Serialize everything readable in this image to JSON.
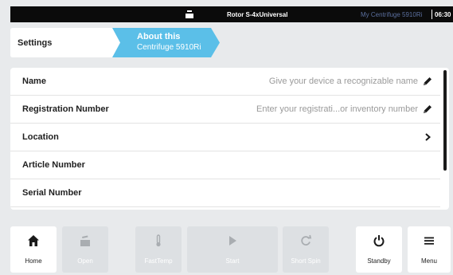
{
  "status_bar": {
    "rotor_icon": "rotor-icon",
    "rotor": "Rotor S-4xUniversal",
    "device": "My Centrifuge 5910Ri",
    "time": "06:30"
  },
  "breadcrumb": {
    "home": "Settings",
    "current_line1": "About this",
    "current_line2": "Centrifuge 5910Ri"
  },
  "rows": [
    {
      "label": "Name",
      "value": "Give your device a recognizable name",
      "action_icon": "pencil-icon"
    },
    {
      "label": "Registration Number",
      "value": "Enter your registrati...or inventory number",
      "action_icon": "pencil-icon"
    },
    {
      "label": "Location",
      "value": "",
      "action_icon": "chevron-right-icon"
    },
    {
      "label": "Article Number",
      "value": ""
    },
    {
      "label": "Serial Number",
      "value": ""
    }
  ],
  "nav": [
    {
      "label": "Home",
      "icon": "home-icon",
      "enabled": true
    },
    {
      "label": "Open",
      "icon": "lid-icon",
      "enabled": false
    },
    {
      "label": "FastTemp",
      "icon": "thermometer-icon",
      "enabled": false
    },
    {
      "label": "Start",
      "icon": "play-icon",
      "enabled": false
    },
    {
      "label": "Short Spin",
      "icon": "refresh-icon",
      "enabled": false
    },
    {
      "label": "Standby",
      "icon": "power-icon",
      "enabled": true
    },
    {
      "label": "Menu",
      "icon": "menu-icon",
      "enabled": true
    }
  ],
  "colors": {
    "accent": "#5bbfe8",
    "background": "#e8eaec",
    "statusbar": "#0b0b0b"
  }
}
